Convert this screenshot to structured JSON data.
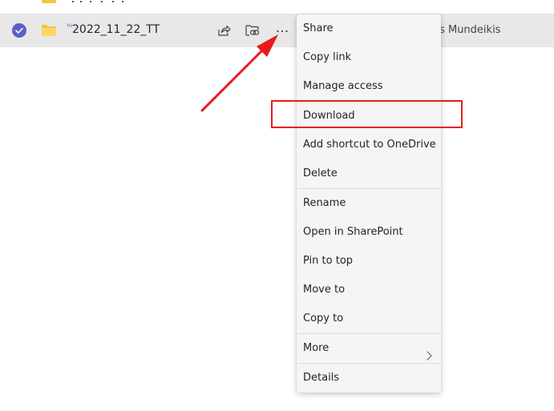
{
  "file_row": {
    "name": "2022_11_22_TT",
    "owner": "Augustas Mundeikis",
    "owner_visible": "ustas Mundeikis",
    "selected": true,
    "icons": [
      "check-circle-icon",
      "folder-icon",
      "sparkle-icon",
      "share-icon",
      "copy-link-icon",
      "more-icon"
    ]
  },
  "context_menu": {
    "items": [
      {
        "label": "Share"
      },
      {
        "label": "Copy link"
      },
      {
        "label": "Manage access"
      },
      {
        "label": "Download"
      },
      {
        "label": "Add shortcut to OneDrive"
      },
      {
        "label": "Delete"
      },
      {
        "label": "Rename"
      },
      {
        "label": "Open in SharePoint"
      },
      {
        "label": "Pin to top"
      },
      {
        "label": "Move to"
      },
      {
        "label": "Copy to"
      },
      {
        "label": "More",
        "has_submenu": true
      },
      {
        "label": "Details"
      }
    ],
    "highlighted": "Download"
  },
  "colors": {
    "accent": "#5b5fc7",
    "folder": "#f6c342",
    "annotation": "#e81b1b",
    "row_selected": "#e8e8e8",
    "menu_bg": "#f5f5f5"
  }
}
